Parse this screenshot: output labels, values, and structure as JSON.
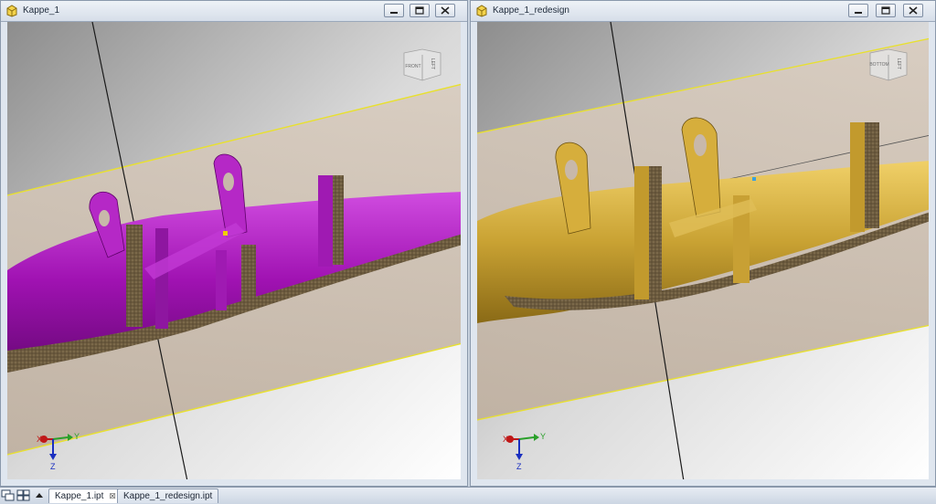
{
  "windows": {
    "left": {
      "title": "Kappe_1",
      "part_color": "#a010b0",
      "viewcube_face_left": "LEFT",
      "viewcube_face_front": "FRONT"
    },
    "right": {
      "title": "Kappe_1_redesign",
      "part_color": "#c9a233",
      "viewcube_face_left": "LEFT",
      "viewcube_face_front": "BOTTOM"
    }
  },
  "window_buttons": [
    "minimize-icon",
    "restore-icon",
    "close-icon"
  ],
  "triad": {
    "x_label": "X",
    "y_label": "Y",
    "z_label": "Z"
  },
  "tabs": [
    {
      "label": "Kappe_1.ipt",
      "active": true
    },
    {
      "label": "Kappe_1_redesign.ipt",
      "active": false
    }
  ],
  "tab_close_glyph": "⊠",
  "colors": {
    "section_plane_edge": "#e8e030",
    "cut_face": "#6b5a3e",
    "x_axis": "#c01818",
    "y_axis": "#2aa02a",
    "z_axis": "#1a2fc0"
  }
}
